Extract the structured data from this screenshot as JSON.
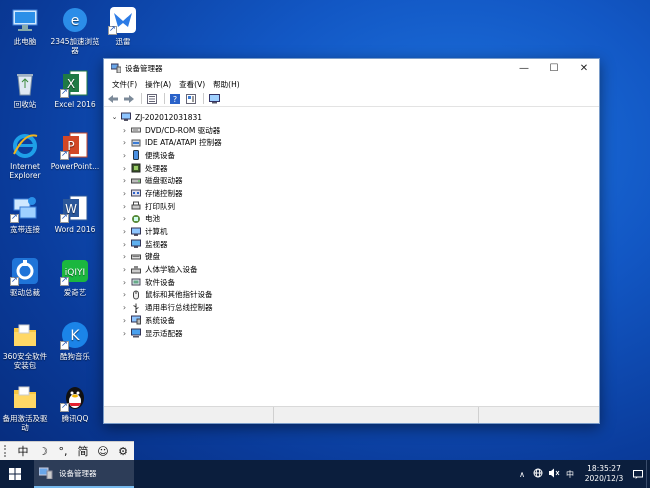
{
  "desktop": {
    "icons": [
      {
        "label": "此电脑",
        "icon": "this-pc-icon"
      },
      {
        "label": "2345加速浏览器",
        "icon": "browser-2345-icon"
      },
      {
        "label": "迅雷",
        "icon": "xunlei-icon"
      },
      {
        "label": "回收站",
        "icon": "recycle-bin-icon"
      },
      {
        "label": "Excel 2016",
        "icon": "excel-icon"
      },
      {
        "label": "Internet Explorer",
        "icon": "internet-explorer-icon"
      },
      {
        "label": "PowerPoint...",
        "icon": "powerpoint-icon"
      },
      {
        "label": "宽带连接",
        "icon": "broadband-icon"
      },
      {
        "label": "Word 2016",
        "icon": "word-icon"
      },
      {
        "label": "驱动总裁",
        "icon": "driver-president-icon"
      },
      {
        "label": "爱奇艺",
        "icon": "iqiyi-icon"
      },
      {
        "label": "360安全软件安装包",
        "icon": "folder-icon"
      },
      {
        "label": "酷狗音乐",
        "icon": "kugou-icon"
      },
      {
        "label": "备用激活及驱动",
        "icon": "folder-icon"
      },
      {
        "label": "腾讯QQ",
        "icon": "qq-icon"
      }
    ]
  },
  "window": {
    "title": "设备管理器",
    "controls": {
      "minimize": "—",
      "maximize": "☐",
      "close": "✕"
    },
    "menu": [
      "文件(F)",
      "操作(A)",
      "查看(V)",
      "帮助(H)"
    ],
    "tree": {
      "root": "ZJ-202012031831",
      "items": [
        {
          "label": "DVD/CD-ROM 驱动器",
          "icon": "dvd-drive-icon"
        },
        {
          "label": "IDE ATA/ATAPI 控制器",
          "icon": "ide-controller-icon"
        },
        {
          "label": "便携设备",
          "icon": "portable-device-icon"
        },
        {
          "label": "处理器",
          "icon": "processor-icon"
        },
        {
          "label": "磁盘驱动器",
          "icon": "disk-drive-icon"
        },
        {
          "label": "存储控制器",
          "icon": "storage-controller-icon"
        },
        {
          "label": "打印队列",
          "icon": "print-queue-icon"
        },
        {
          "label": "电池",
          "icon": "battery-icon"
        },
        {
          "label": "计算机",
          "icon": "computer-icon"
        },
        {
          "label": "监视器",
          "icon": "monitor-icon"
        },
        {
          "label": "键盘",
          "icon": "keyboard-icon"
        },
        {
          "label": "人体学输入设备",
          "icon": "hid-icon"
        },
        {
          "label": "软件设备",
          "icon": "software-device-icon"
        },
        {
          "label": "鼠标和其他指针设备",
          "icon": "mouse-icon"
        },
        {
          "label": "通用串行总线控制器",
          "icon": "usb-icon"
        },
        {
          "label": "系统设备",
          "icon": "system-device-icon"
        },
        {
          "label": "显示适配器",
          "icon": "display-adapter-icon"
        }
      ]
    }
  },
  "ime": {
    "items": [
      "中",
      "☽",
      "°,",
      "简",
      "☺",
      "⚙"
    ]
  },
  "taskbar": {
    "task_label": "设备管理器",
    "tray": {
      "chevron": "∧",
      "ime_indicator": "中",
      "time": "18:35:27",
      "date": "2020/12/3"
    }
  },
  "colors": {
    "accent": "#0078d7",
    "taskbar": "#0b1e3d",
    "desktop": "#1257c4"
  }
}
